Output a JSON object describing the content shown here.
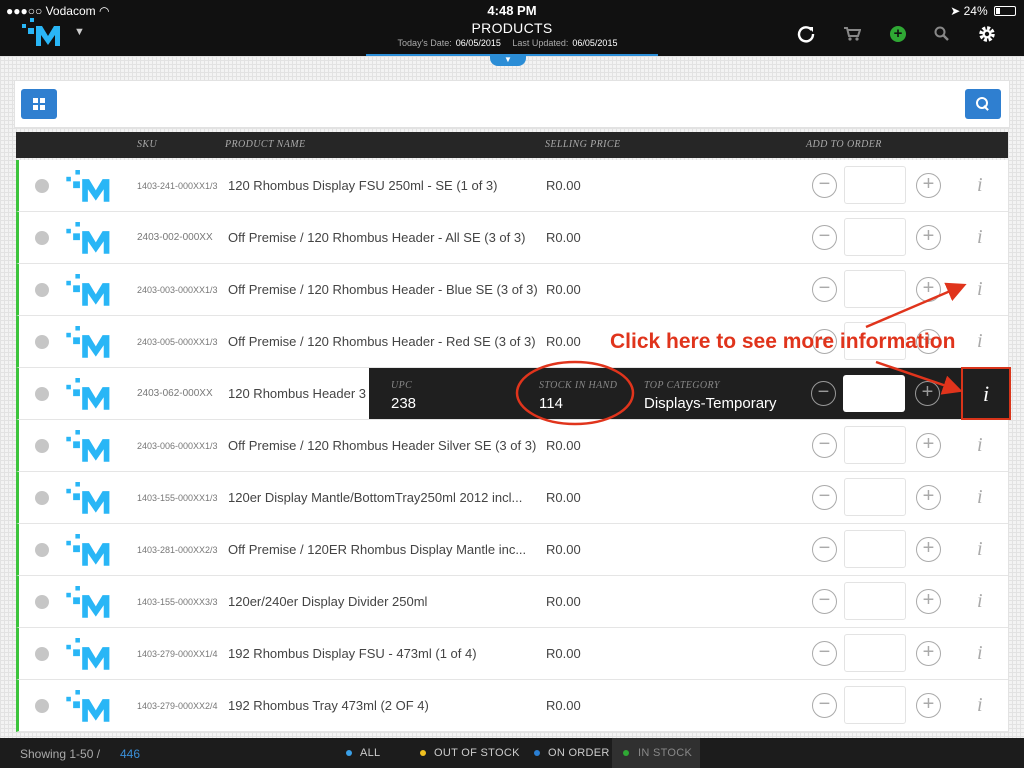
{
  "status": {
    "carrier": "Vodacom",
    "time": "4:48 PM",
    "battery": "24%"
  },
  "header": {
    "title": "PRODUCTS",
    "today_label": "Today's Date:",
    "today_value": "06/05/2015",
    "updated_label": "Last Updated:",
    "updated_value": "06/05/2015",
    "add_icon_color": "#2fa834"
  },
  "table": {
    "headers": {
      "sku": "SKU",
      "name": "PRODUCT NAME",
      "price": "SELLING PRICE",
      "add": "ADD TO ORDER"
    },
    "rows": [
      {
        "sku": "1403-241-000XX1/3",
        "name": "120 Rhombus Display FSU 250ml - SE (1 of 3)",
        "price": "R0.00"
      },
      {
        "sku": "2403-002-000XX",
        "name": "Off Premise / 120 Rhombus Header - All SE (3 of 3)",
        "price": "R0.00"
      },
      {
        "sku": "2403-003-000XX1/3",
        "name": "Off Premise / 120 Rhombus Header - Blue SE (3 of 3)",
        "price": "R0.00"
      },
      {
        "sku": "2403-005-000XX1/3",
        "name": "Off Premise / 120 Rhombus Header - Red SE (3 of 3)",
        "price": "R0.00"
      },
      {
        "sku": "2403-062-000XX",
        "name": "120 Rhombus Header 3",
        "price": ""
      },
      {
        "sku": "2403-006-000XX1/3",
        "name": "Off Premise / 120 Rhombus Header Silver SE (3 of 3)",
        "price": "R0.00"
      },
      {
        "sku": "1403-155-000XX1/3",
        "name": "120er Display Mantle/BottomTray250ml 2012 incl...",
        "price": "R0.00"
      },
      {
        "sku": "1403-281-000XX2/3",
        "name": "Off Premise / 120ER Rhombus Display Mantle inc...",
        "price": "R0.00"
      },
      {
        "sku": "1403-155-000XX3/3",
        "name": "120er/240er Display Divider 250ml",
        "price": "R0.00"
      },
      {
        "sku": "1403-279-000XX1/4",
        "name": "192 Rhombus Display FSU - 473ml (1 of 4)",
        "price": "R0.00"
      },
      {
        "sku": "1403-279-000XX2/4",
        "name": "192 Rhombus Tray 473ml (2 OF 4)",
        "price": "R0.00"
      }
    ],
    "info_glyph": "i",
    "minus_glyph": "−",
    "plus_glyph": "+"
  },
  "detail": {
    "upc_label": "UPC",
    "upc_value": "238",
    "stock_label": "STOCK IN HAND",
    "stock_value": "114",
    "category_label": "TOP CATEGORY",
    "category_value": "Displays-Temporary"
  },
  "annotation": {
    "text": "Click here to see more information",
    "color": "#e0341c"
  },
  "footer": {
    "showing": "Showing 1-50 /",
    "total": "446",
    "filters": [
      {
        "label": "ALL",
        "color": "#3aa0e8"
      },
      {
        "label": "OUT OF STOCK",
        "color": "#f0c020"
      },
      {
        "label": "ON ORDER",
        "color": "#2a7fd4"
      },
      {
        "label": "IN STOCK",
        "color": "#2fa834"
      }
    ]
  }
}
